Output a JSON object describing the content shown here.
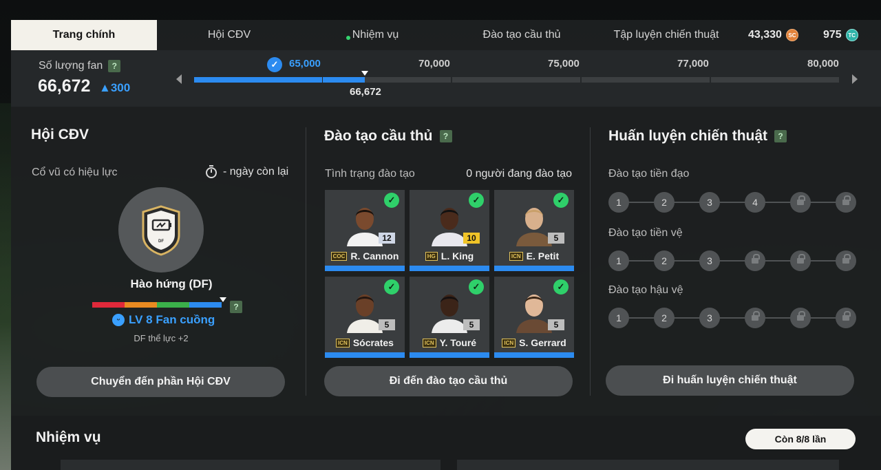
{
  "tabs": [
    {
      "label": "Trang chính",
      "active": true
    },
    {
      "label": "Hội CĐV",
      "active": false
    },
    {
      "label": "Nhiệm vụ",
      "active": false,
      "notification_dot": true
    },
    {
      "label": "Đào tạo cầu thủ",
      "active": false
    },
    {
      "label": "Tập luyện chiến thuật",
      "active": false
    }
  ],
  "currency": {
    "sc_value": "43,330",
    "sc_icon": "SC",
    "tc_value": "975",
    "tc_icon": "TC"
  },
  "fans": {
    "label": "Số lượng fan",
    "help": "?",
    "count": "66,672",
    "delta": "300",
    "current_marker": "66,672",
    "milestones": [
      "65,000",
      "70,000",
      "75,000",
      "77,000",
      "80,000"
    ],
    "milestone_reached_index": 0,
    "progress_in_segment": 0.33,
    "check_icon": "✓"
  },
  "fan_club": {
    "title": "Hội CĐV",
    "effect_label": "Cổ vũ có hiệu lực",
    "timer_text": "- ngày còn lại",
    "badge_text": "DF",
    "club_mood": "Hào hứng (DF)",
    "mood_colors": [
      "#e0293a",
      "#e98a21",
      "#3bb04a",
      "#2c8bf0"
    ],
    "help": "?",
    "level": "LV 8 Fan cuồng",
    "level_effect": "DF thể lực +2",
    "button": "Chuyển đến phần Hội CĐV"
  },
  "player_training": {
    "title": "Đào tạo cầu thủ",
    "help": "?",
    "status_label": "Tình trạng đào tạo",
    "status_value": "0 người đang đào tạo",
    "players": [
      {
        "name": "R. Cannon",
        "tag": "COC",
        "level": "12",
        "level_bg": "#cfd7e6"
      },
      {
        "name": "L. King",
        "tag": "HG",
        "level": "10",
        "level_bg": "#f0c428"
      },
      {
        "name": "E. Petit",
        "tag": "ICN",
        "level": "5",
        "level_bg": "#bdbdbd"
      },
      {
        "name": "Sócrates",
        "tag": "ICN",
        "level": "5",
        "level_bg": "#bdbdbd"
      },
      {
        "name": "Y. Touré",
        "tag": "ICN",
        "level": "5",
        "level_bg": "#bdbdbd"
      },
      {
        "name": "S. Gerrard",
        "tag": "ICN",
        "level": "5",
        "level_bg": "#bdbdbd"
      }
    ],
    "check_icon": "✓",
    "button": "Đi đến đào tạo cầu thủ"
  },
  "tactics": {
    "title": "Huấn luyện chiến thuật",
    "help": "?",
    "rows": [
      {
        "label": "Đào tạo tiền đạo",
        "steps": [
          "1",
          "2",
          "3",
          "4"
        ],
        "locked_count": 2
      },
      {
        "label": "Đào tạo tiền vệ",
        "steps": [
          "1",
          "2",
          "3"
        ],
        "locked_count": 3
      },
      {
        "label": "Đào tạo hậu vệ",
        "steps": [
          "1",
          "2",
          "3"
        ],
        "locked_count": 3
      }
    ],
    "button": "Đi huấn luyện chiến thuật"
  },
  "missions": {
    "title": "Nhiệm vụ",
    "remaining": "Còn 8/8 lần"
  }
}
